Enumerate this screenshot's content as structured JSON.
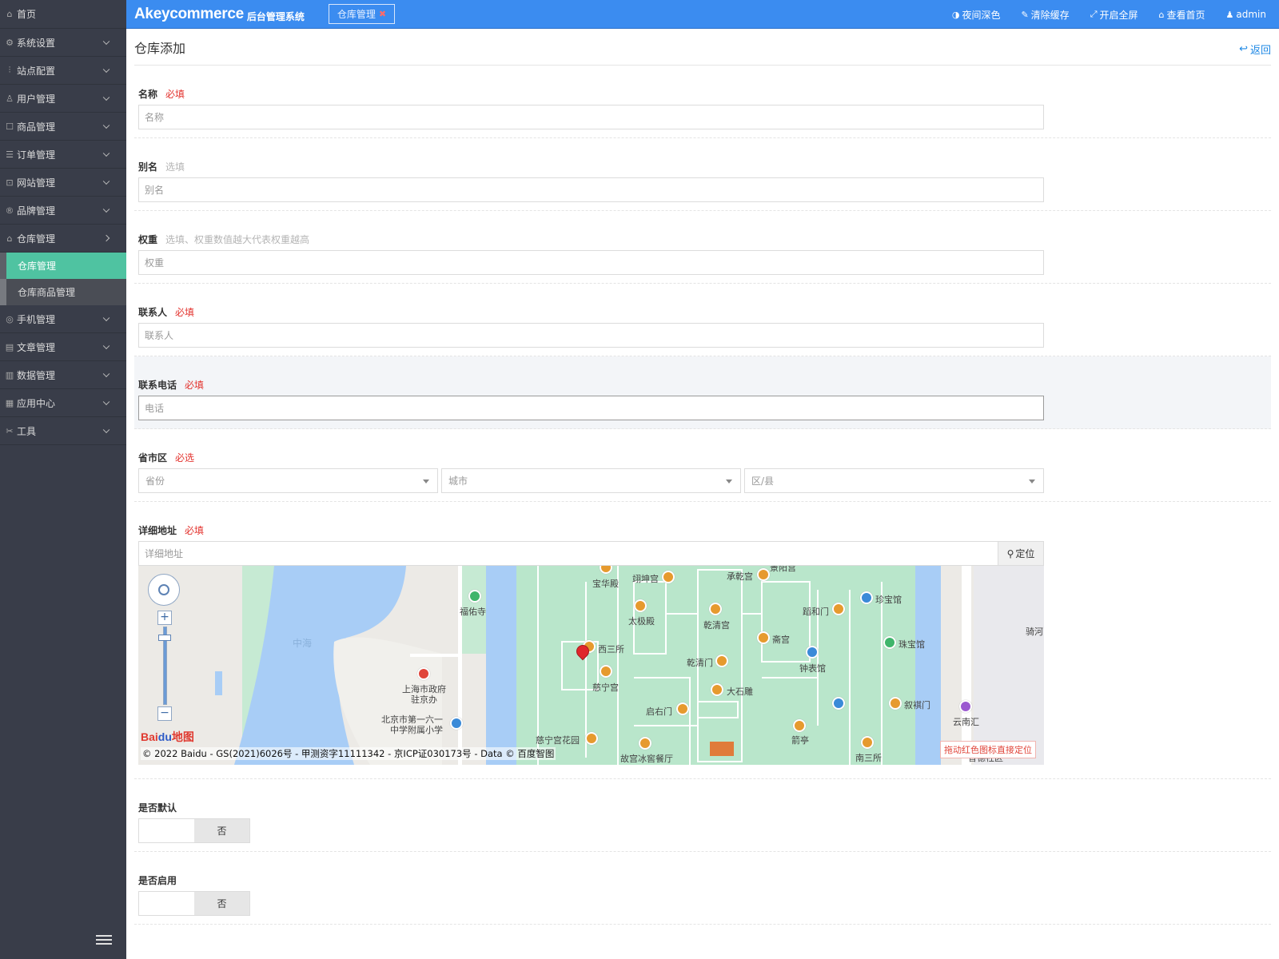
{
  "sidebar": {
    "items": [
      {
        "icon": "home-icon",
        "glyph": "⌂",
        "label": "首页"
      },
      {
        "icon": "gear-icon",
        "glyph": "⚙",
        "label": "系统设置"
      },
      {
        "icon": "sliders-icon",
        "glyph": "⫶",
        "label": "站点配置"
      },
      {
        "icon": "user-icon",
        "glyph": "♙",
        "label": "用户管理"
      },
      {
        "icon": "goods-icon",
        "glyph": "☐",
        "label": "商品管理"
      },
      {
        "icon": "order-icon",
        "glyph": "☰",
        "label": "订单管理"
      },
      {
        "icon": "web-icon",
        "glyph": "⊡",
        "label": "网站管理"
      },
      {
        "icon": "brand-icon",
        "glyph": "®",
        "label": "品牌管理"
      },
      {
        "icon": "warehouse-icon",
        "glyph": "⌂",
        "label": "仓库管理"
      }
    ],
    "sub_items": [
      "仓库管理",
      "仓库商品管理"
    ],
    "items_after": [
      {
        "icon": "phone-icon",
        "glyph": "◎",
        "label": "手机管理"
      },
      {
        "icon": "article-icon",
        "glyph": "▤",
        "label": "文章管理"
      },
      {
        "icon": "database-icon",
        "glyph": "▥",
        "label": "数据管理"
      },
      {
        "icon": "apps-icon",
        "glyph": "▦",
        "label": "应用中心"
      },
      {
        "icon": "tools-icon",
        "glyph": "✂",
        "label": "工具"
      }
    ]
  },
  "header": {
    "brand": "Akeycommerce",
    "brand_sub": "后台管理系统",
    "tab_label": "仓库管理",
    "tab_close": "✖",
    "buttons": [
      {
        "icon": "moon-icon",
        "glyph": "◑",
        "label": "夜间深色"
      },
      {
        "icon": "brush-icon",
        "glyph": "✎",
        "label": "清除缓存"
      },
      {
        "icon": "fullscreen-icon",
        "glyph": "⤢",
        "label": "开启全屏"
      },
      {
        "icon": "home-icon",
        "glyph": "⌂",
        "label": "查看首页"
      },
      {
        "icon": "user-icon",
        "glyph": "♟",
        "label": "admin"
      }
    ]
  },
  "page": {
    "title": "仓库添加",
    "back_icon": "↩",
    "back_label": "返回"
  },
  "form": {
    "name": {
      "label": "名称",
      "tip": "必填",
      "placeholder": "名称"
    },
    "alias": {
      "label": "别名",
      "tip": "选填",
      "placeholder": "别名"
    },
    "weight": {
      "label": "权重",
      "tip": "选填、权重数值越大代表权重越高",
      "placeholder": "权重"
    },
    "contact": {
      "label": "联系人",
      "tip": "必填",
      "placeholder": "联系人"
    },
    "phone": {
      "label": "联系电话",
      "tip": "必填",
      "placeholder": "电话"
    },
    "region": {
      "label": "省市区",
      "tip": "必选",
      "province": "省份",
      "city": "城市",
      "district": "区/县"
    },
    "address": {
      "label": "详细地址",
      "tip": "必填",
      "placeholder": "详细地址",
      "locate_icon": "⚲",
      "locate_label": "定位"
    },
    "is_default": {
      "label": "是否默认",
      "value": "否"
    },
    "is_enabled": {
      "label": "是否启用",
      "value": "否"
    }
  },
  "map": {
    "labels": {
      "zhonghai": "中海",
      "fuyousi": "福佑寺",
      "shanghai": "上海市政府",
      "shanghai2": "驻京办",
      "school1": "北京市第一六一",
      "school2": "中学附属小学",
      "baohuadian": "宝华殿",
      "yikungong": "翊坤宫",
      "chengqiangong": "承乾宫",
      "jingyanggong": "景阳宫",
      "taijidian": "太极殿",
      "qianqinggong": "乾清宫",
      "xisansuo": "西三所",
      "cininggong": "慈宁宫",
      "zhaigong": "斋宫",
      "daomen": "蹈和门",
      "zhenbaoguan": "珍宝馆",
      "zhubaoguan": "珠宝馆",
      "zhongbiaoguan": "钟表馆",
      "qianqingmen": "乾清门",
      "dashidiao": "大石雕",
      "houyoumen": "启右门",
      "xuqimen": "叙褀门",
      "yunnanhui": "云南汇",
      "qi": "骑河",
      "cininghuayuan": "慈宁宫花园",
      "jianting": "箭亭",
      "nansansuo": "南三所",
      "canting": "故宫冰窖餐厅",
      "shequ": "普德社区"
    },
    "logo_text": "Bai",
    "logo_paw": "du",
    "logo_suffix": "地图",
    "copyright": "© 2022 Baidu - GS(2021)6026号 - 甲测资字11111342 - 京ICP证030173号 - Data © 百度智图",
    "hint": "拖动红色图标直接定位",
    "zoom_in": "+",
    "zoom_out": "−"
  },
  "colors": {
    "header_bg": "#3b8cf0",
    "sidebar_bg": "#393D49",
    "active_bg": "#4fc3a1",
    "required": "#e3322d"
  }
}
